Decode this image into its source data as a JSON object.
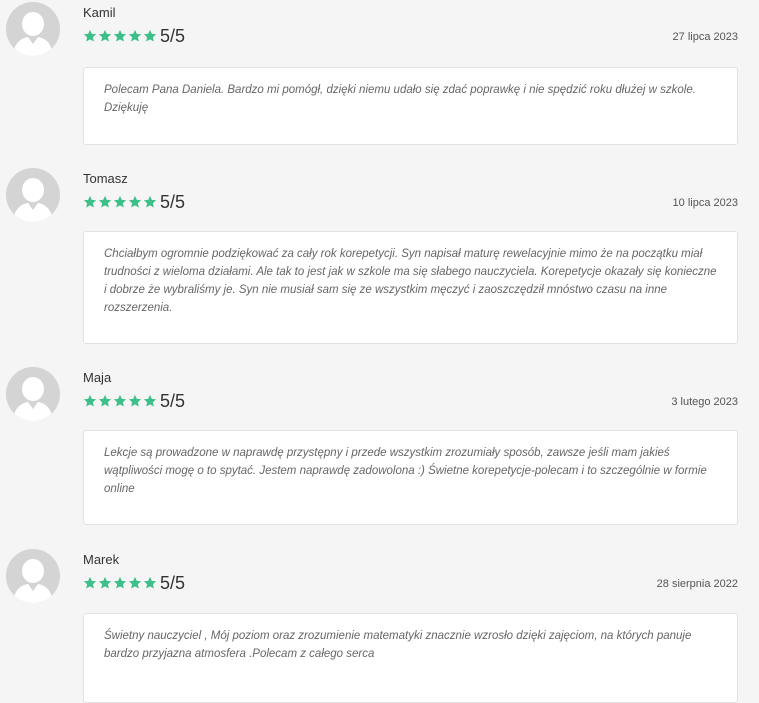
{
  "colors": {
    "star": "#3dbf8a",
    "avatar_bg": "#d4d4d4",
    "avatar_fg": "#ffffff"
  },
  "reviews": [
    {
      "name": "Kamil",
      "rating": 5,
      "score": "5/5",
      "date": "27 lipca 2023",
      "text": "Polecam Pana Daniela. Bardzo mi pomógł, dzięki niemu udało się zdać poprawkę i nie spędzić roku dłużej w szkole. Dziękuję"
    },
    {
      "name": "Tomasz",
      "rating": 5,
      "score": "5/5",
      "date": "10 lipca 2023",
      "text": "Chciałbym ogromnie podziękować za cały rok korepetycji. Syn napisał maturę rewelacyjnie mimo że na początku miał trudności z wieloma działami. Ale tak to jest jak w szkole ma się słabego nauczyciela. Korepetycje okazały się konieczne i dobrze że wybraliśmy je. Syn nie musiał sam się ze wszystkim męczyć i zaoszczędził mnóstwo czasu na inne rozszerzenia."
    },
    {
      "name": "Maja",
      "rating": 5,
      "score": "5/5",
      "date": "3 lutego 2023",
      "text": "Lekcje są prowadzone w naprawdę przystępny i przede wszystkim zrozumiały sposób, zawsze jeśli mam jakieś wątpliwości mogę o to spytać. Jestem naprawdę zadowolona :) Świetne korepetycje-polecam i to szczególnie w formie online"
    },
    {
      "name": "Marek",
      "rating": 5,
      "score": "5/5",
      "date": "28 sierpnia 2022",
      "text": "Świetny nauczyciel , Mój poziom oraz zrozumienie matematyki znacznie wzrosło dzięki zajęciom, na których panuje bardzo przyjazna atmosfera .Polecam z całego serca"
    }
  ]
}
